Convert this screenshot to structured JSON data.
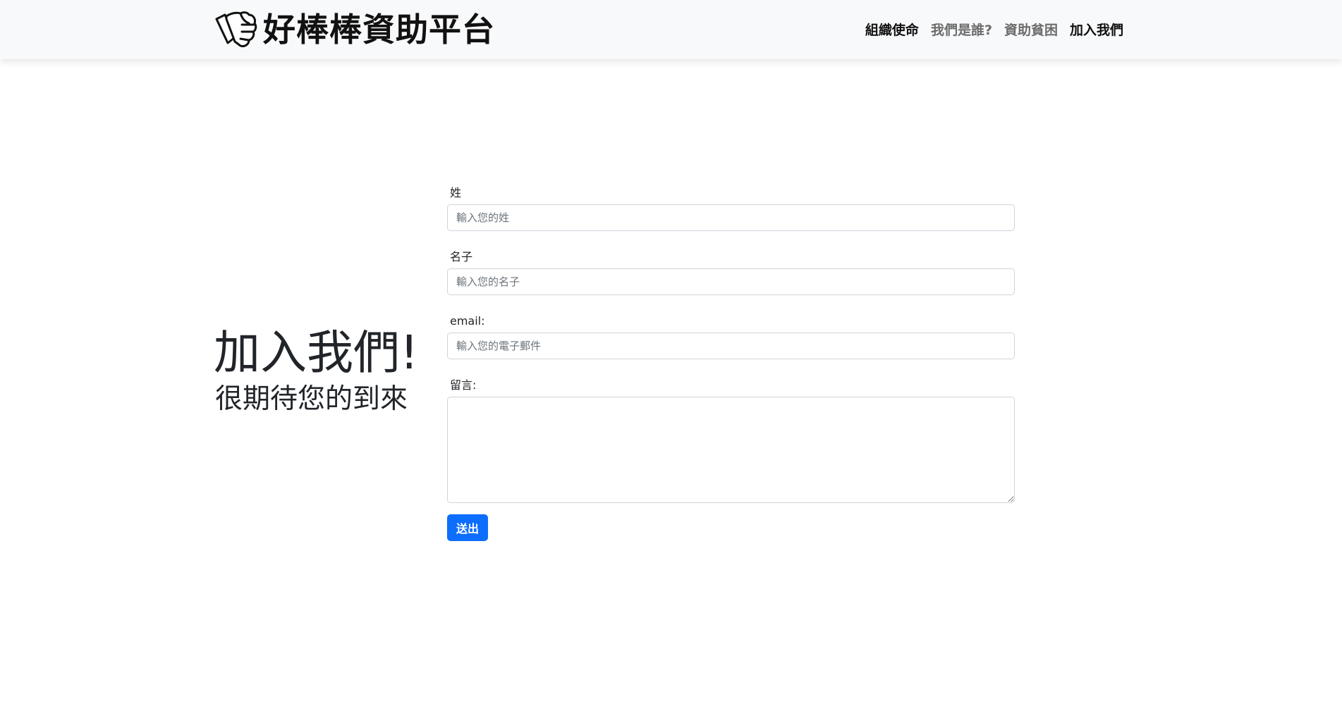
{
  "navbar": {
    "brand_title": "好棒棒資助平台",
    "brand_logo_icon": "thumbs-up-hand-icon",
    "links": [
      {
        "label": "組織使命",
        "style": "dark"
      },
      {
        "label": "我們是誰?",
        "style": "muted"
      },
      {
        "label": "資助貧困",
        "style": "muted"
      },
      {
        "label": "加入我們",
        "style": "dark"
      }
    ]
  },
  "hero": {
    "heading": "加入我們!",
    "subheading": "很期待您的到來"
  },
  "form": {
    "last_name": {
      "label": "姓",
      "placeholder": "輸入您的姓",
      "value": ""
    },
    "first_name": {
      "label": "名子",
      "placeholder": "輸入您的名子",
      "value": ""
    },
    "email": {
      "label": "email:",
      "placeholder": "輸入您的電子郵件",
      "value": ""
    },
    "message": {
      "label": "留言:",
      "value": ""
    },
    "submit_label": "送出"
  },
  "colors": {
    "navbar_bg": "#f8f9fa",
    "primary": "#0d6efd",
    "nav_muted": "#6c6c6c",
    "nav_dark": "#111111"
  }
}
